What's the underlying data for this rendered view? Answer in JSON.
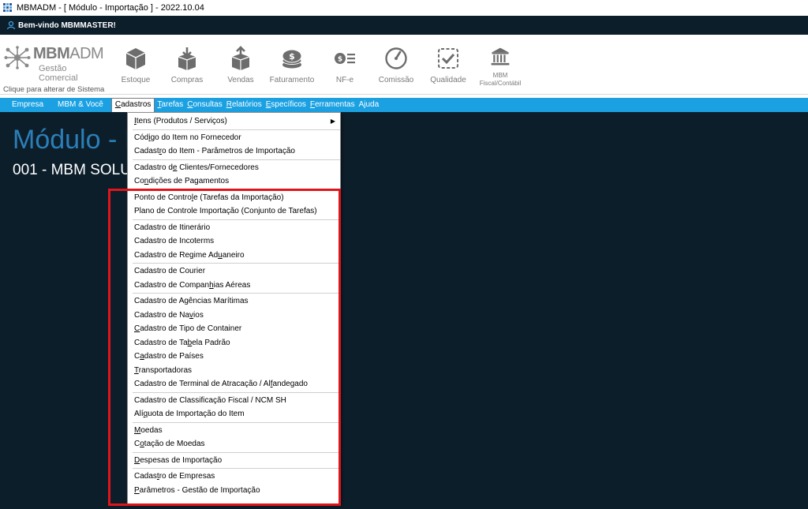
{
  "window": {
    "title": "MBMADM - [ Módulo - Importação ] - 2022.10.04"
  },
  "welcome": {
    "text": "Bem-vindo MBMMASTER!"
  },
  "logo": {
    "name_bold": "MBM",
    "name_light": "ADM",
    "subtitle": "Gestão Comercial"
  },
  "switch_system_label": "Clique para alterar de Sistema",
  "toolbar": [
    {
      "label": "Estoque",
      "icon": "box-icon"
    },
    {
      "label": "Compras",
      "icon": "box-in-icon"
    },
    {
      "label": "Vendas",
      "icon": "box-out-icon"
    },
    {
      "label": "Faturamento",
      "icon": "coins-icon"
    },
    {
      "label": "NF-e",
      "icon": "nfe-list-icon"
    },
    {
      "label": "Comissão",
      "icon": "gauge-icon"
    },
    {
      "label": "Qualidade",
      "icon": "checkbox-icon"
    },
    {
      "label": "MBM Fiscal/Contábil",
      "label_line1": "MBM",
      "label_line2": "Fiscal/Contábil",
      "icon": "bank-icon"
    }
  ],
  "menubar": [
    {
      "u": "",
      "rest": "Empresa"
    },
    {
      "u": "",
      "rest": "MBM & Você"
    },
    {
      "u": "C",
      "rest": "adastros"
    },
    {
      "u": "T",
      "rest": "arefas"
    },
    {
      "u": "C",
      "rest": "onsultas"
    },
    {
      "u": "R",
      "rest": "elatórios"
    },
    {
      "u": "E",
      "rest": "specíficos"
    },
    {
      "u": "F",
      "rest": "erramentas"
    },
    {
      "u": "",
      "rest": "Ajuda"
    }
  ],
  "module": {
    "title": "Módulo - Importação",
    "subtitle": "001 - MBM SOLUÇÕES"
  },
  "dropdown": [
    {
      "pre": "",
      "u": "I",
      "post": "tens (Produtos / Serviços)",
      "submenu": true
    },
    {
      "sep": true
    },
    {
      "pre": "Cód",
      "u": "i",
      "post": "go do Item no Fornecedor"
    },
    {
      "pre": "Cadast",
      "u": "r",
      "post": "o do Item - Parâmetros de Importação"
    },
    {
      "sep": true
    },
    {
      "pre": "Cadastro d",
      "u": "e",
      "post": " Clientes/Fornecedores"
    },
    {
      "pre": "Co",
      "u": "n",
      "post": "dições de Pagamentos"
    },
    {
      "sep": true
    },
    {
      "pre": "Ponto de Contro",
      "u": "l",
      "post": "e (Tarefas da Importação)"
    },
    {
      "pre": "Plano de Controle Importação (Conjunto de Tarefas)",
      "u": "",
      "post": ""
    },
    {
      "sep": true
    },
    {
      "pre": "Cadastro de Itinerário",
      "u": "",
      "post": ""
    },
    {
      "pre": "Cadastro de Incoterms",
      "u": "",
      "post": ""
    },
    {
      "pre": "Cadastro de Regime Ad",
      "u": "u",
      "post": "aneiro"
    },
    {
      "sep": true
    },
    {
      "pre": "Cadastro de Courier",
      "u": "",
      "post": ""
    },
    {
      "pre": "Cadastro de Compan",
      "u": "h",
      "post": "ias Aéreas"
    },
    {
      "sep": true
    },
    {
      "pre": "Cadastro de Agências Marítimas",
      "u": "",
      "post": ""
    },
    {
      "pre": "Cadastro de Na",
      "u": "v",
      "post": "ios"
    },
    {
      "pre": "",
      "u": "C",
      "post": "adastro de Tipo de Container"
    },
    {
      "pre": "Cadastro de Ta",
      "u": "b",
      "post": "ela Padrão"
    },
    {
      "pre": "C",
      "u": "a",
      "post": "dastro de Países"
    },
    {
      "pre": "",
      "u": "T",
      "post": "ransportadoras"
    },
    {
      "pre": "Cadastro de Terminal de Atracação / Al",
      "u": "f",
      "post": "andegado"
    },
    {
      "sep": true
    },
    {
      "pre": "Cadastro de Classificação Fiscal / NCM SH",
      "u": "",
      "post": ""
    },
    {
      "pre": "Alí",
      "u": "q",
      "post": "uota de Importação do Item"
    },
    {
      "sep": true
    },
    {
      "pre": "",
      "u": "M",
      "post": "oedas"
    },
    {
      "pre": "C",
      "u": "o",
      "post": "tação de Moedas"
    },
    {
      "sep": true
    },
    {
      "pre": "",
      "u": "D",
      "post": "espesas de Importação"
    },
    {
      "sep": true
    },
    {
      "pre": "Cadas",
      "u": "t",
      "post": "ro de Empresas"
    },
    {
      "pre": "",
      "u": "P",
      "post": "arâmetros - Gestão de Importação"
    }
  ],
  "colors": {
    "dark_bg": "#0d1e2b",
    "menubar": "#1ba1e2",
    "module_title": "#2b7fb8",
    "highlight": "#e0151b"
  }
}
